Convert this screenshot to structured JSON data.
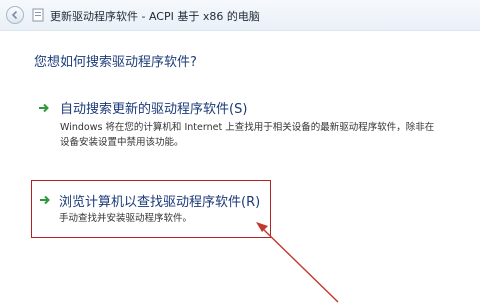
{
  "window": {
    "title": "更新驱动程序软件 - ACPI 基于 x86 的电脑"
  },
  "question": "您想如何搜索驱动程序软件?",
  "options": [
    {
      "title": "自动搜索更新的驱动程序软件(S)",
      "description": "Windows 将在您的计算机和 Internet 上查找用于相关设备的最新驱动程序软件，除非在设备安装设置中禁用该功能。"
    },
    {
      "title": "浏览计算机以查找驱动程序软件(R)",
      "description": "手动查找并安装驱动程序软件。"
    }
  ],
  "colors": {
    "option_arrow": "#2e9a3c",
    "highlight_border": "#b12323",
    "annotation_arrow": "#c0392b"
  },
  "icons": {
    "back": "back-arrow-icon",
    "title": "document-icon",
    "option": "green-arrow-icon"
  }
}
